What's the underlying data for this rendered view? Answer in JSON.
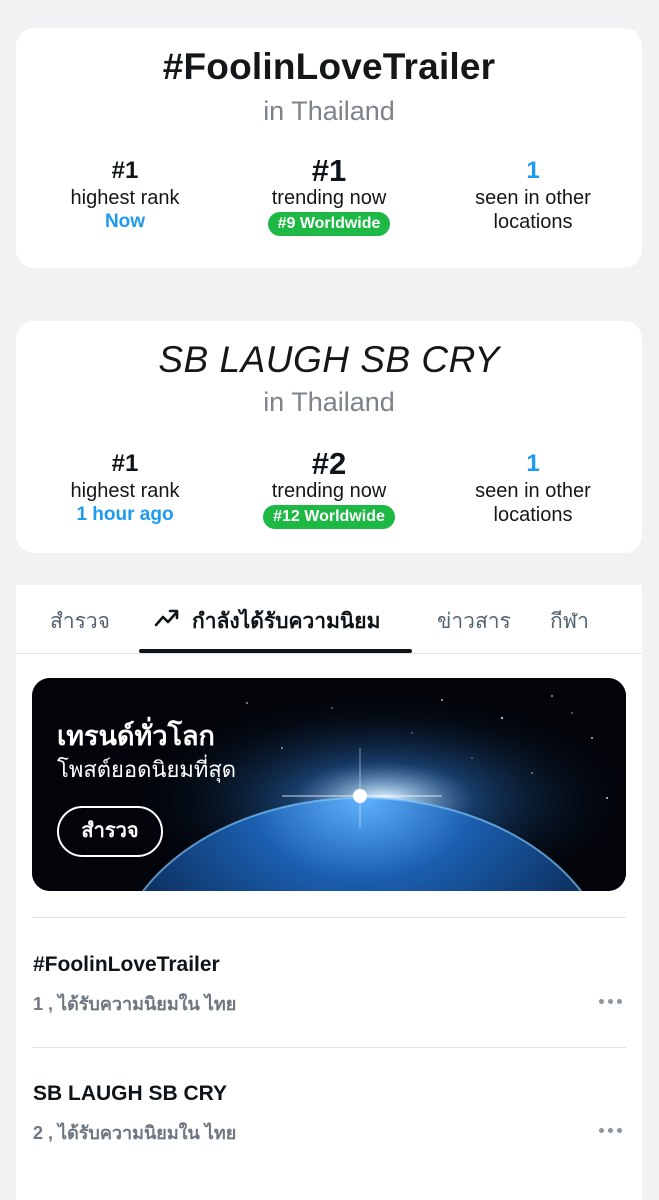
{
  "cards": [
    {
      "title": "#FoolinLoveTrailer",
      "location": "in Thailand",
      "highest_rank": {
        "value": "#1",
        "label": "highest rank",
        "when": "Now"
      },
      "trending": {
        "value": "#1",
        "label": "trending now",
        "badge": "#9 Worldwide"
      },
      "other": {
        "value": "1",
        "label_line1": "seen in other",
        "label_line2": "locations"
      }
    },
    {
      "title": "SB LAUGH SB CRY",
      "location": "in Thailand",
      "highest_rank": {
        "value": "#1",
        "label": "highest rank",
        "when": "1 hour ago"
      },
      "trending": {
        "value": "#2",
        "label": "trending now",
        "badge": "#12 Worldwide"
      },
      "other": {
        "value": "1",
        "label_line1": "seen in other",
        "label_line2": "locations"
      }
    }
  ],
  "tabs": [
    {
      "label": "สำรวจ",
      "active": false
    },
    {
      "label": "กำลังได้รับความนิยม",
      "active": true,
      "icon": "trending-icon"
    },
    {
      "label": "ข่าวสาร",
      "active": false
    },
    {
      "label": "กีฬา",
      "active": false
    }
  ],
  "banner": {
    "title": "เทรนด์ทั่วโลก",
    "subtitle": "โพสต์ยอดนิยมที่สุด",
    "button": "สำรวจ"
  },
  "trends": [
    {
      "name": "#FoolinLoveTrailer",
      "meta": "1 , ได้รับความนิยมใน ไทย"
    },
    {
      "name": "SB LAUGH SB CRY",
      "meta": "2 , ได้รับความนิยมใน ไทย"
    }
  ],
  "colors": {
    "accent": "#1d9bf0",
    "badge": "#1eb845",
    "text": "#0f1419",
    "muted": "#536471"
  }
}
